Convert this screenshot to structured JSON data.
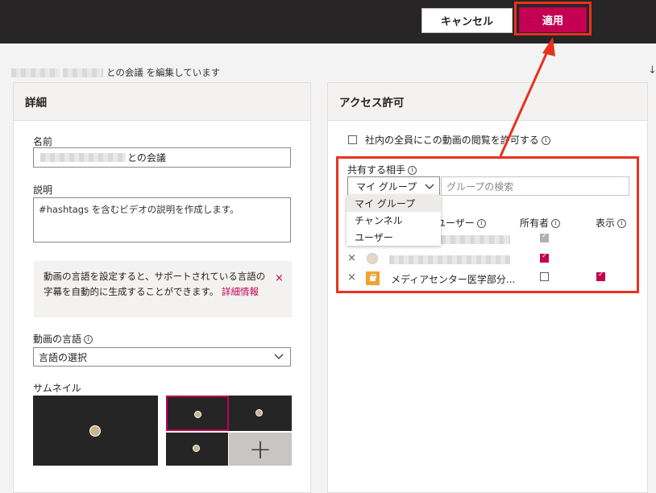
{
  "topbar": {
    "cancel_label": "キャンセル",
    "apply_label": "適用"
  },
  "editing": {
    "suffix": "との会議 を編集しています"
  },
  "details": {
    "heading": "詳細",
    "name_label": "名前",
    "name_value_suffix": "との会議",
    "description_label": "説明",
    "description_placeholder": "#hashtags を含むビデオの説明を作成します。",
    "notice_text": "動画の言語を設定すると、サポートされている言語の字幕を自動的に生成することができます。",
    "notice_link": "詳細情報",
    "language_label": "動画の言語",
    "language_value": "言語の選択",
    "thumbnail_label": "サムネイル"
  },
  "access": {
    "heading": "アクセス許可",
    "allow_all_label": "社内の全員にこの動画の閲覧を許可する",
    "share_with_label": "共有する相手",
    "share_type_value": "マイ グループ",
    "group_search_placeholder": "グループの検索",
    "dropdown_options": [
      "マイ グループ",
      "チャンネル",
      "ユーザー"
    ],
    "columns": {
      "user": "ユーザー",
      "owner": "所有者",
      "display": "表示"
    },
    "rows": [
      {
        "name": "",
        "owner": "checked-disabled",
        "display": ""
      },
      {
        "name": "",
        "owner": "checked",
        "display": ""
      },
      {
        "name": "メディアセンター医学部分...",
        "owner": "unchecked",
        "display": "checked"
      }
    ]
  },
  "colors": {
    "accent": "#c30052",
    "highlight": "#e8321d",
    "topbar": "#272525"
  }
}
